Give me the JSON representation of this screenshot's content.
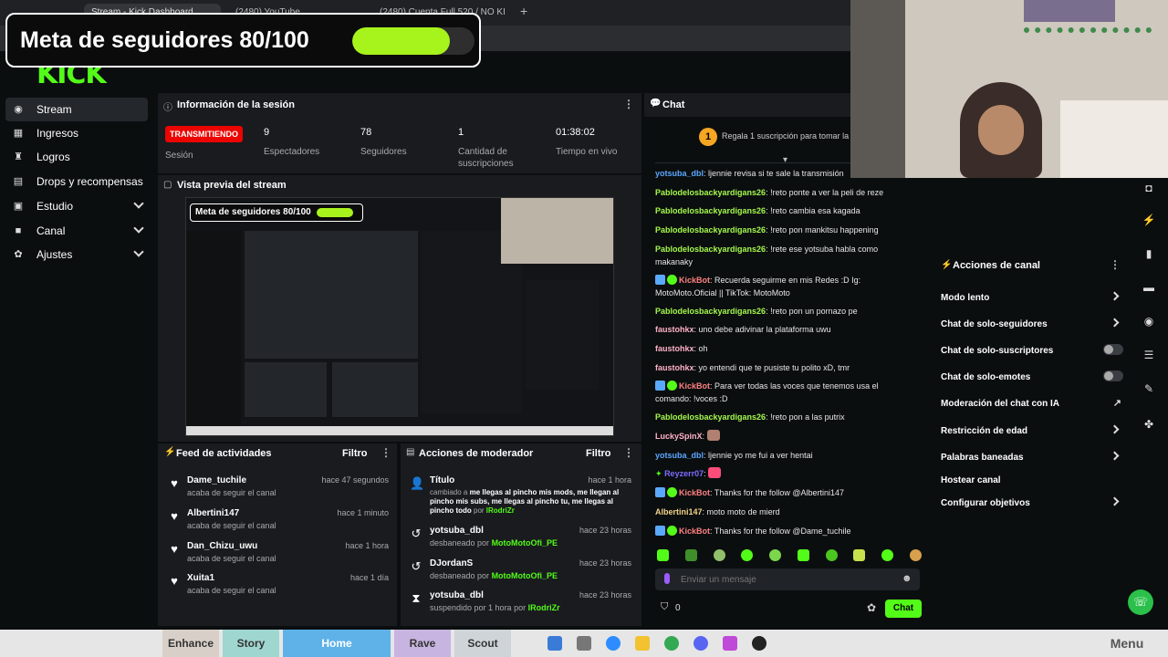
{
  "browser": {
    "tabs": [
      "Stream - Kick Dashboard",
      "(2480) YouTube",
      "(2480) Cuenta Full 520 / NO KI"
    ]
  },
  "goal": {
    "text": "Meta de seguidores 80/100",
    "fraction": 0.8
  },
  "logo": "KICK",
  "sidebar": {
    "items": [
      {
        "label": "Stream",
        "icon": "circle-dot-icon"
      },
      {
        "label": "Ingresos",
        "icon": "cash-icon"
      },
      {
        "label": "Logros",
        "icon": "trophy-icon"
      },
      {
        "label": "Drops y recompensas",
        "icon": "grid-icon"
      },
      {
        "label": "Estudio",
        "icon": "studio-icon"
      },
      {
        "label": "Canal",
        "icon": "channel-icon"
      },
      {
        "label": "Ajustes",
        "icon": "gear-icon"
      }
    ]
  },
  "session": {
    "title": "Información de la sesión",
    "status": "TRANSMITIENDO",
    "status_label": "Sesión",
    "stats": [
      {
        "value": "9",
        "label": "Espectadores"
      },
      {
        "value": "78",
        "label": "Seguidores"
      },
      {
        "value": "1",
        "label": "Cantidad de suscripciones"
      },
      {
        "value": "01:38:02",
        "label": "Tiempo en vivo"
      }
    ]
  },
  "preview": {
    "title": "Vista previa del stream",
    "goal_text": "Meta de seguidores 80/100"
  },
  "activity": {
    "title": "Feed de actividades",
    "filter": "Filtro",
    "items": [
      {
        "name": "Dame_tuchile",
        "sub": "acaba de seguir el canal",
        "time": "hace 47 segundos"
      },
      {
        "name": "Albertini147",
        "sub": "acaba de seguir el canal",
        "time": "hace 1 minuto"
      },
      {
        "name": "Dan_Chizu_uwu",
        "sub": "acaba de seguir el canal",
        "time": "hace 1 hora"
      },
      {
        "name": "Xuita1",
        "sub": "acaba de seguir el canal",
        "time": "hace 1 día"
      }
    ]
  },
  "modactions": {
    "title": "Acciones de moderador",
    "filter": "Filtro",
    "items": [
      {
        "name": "Título",
        "time": "hace 1 hora",
        "pre": "cambiado a ",
        "bold": "me llegas al pincho mis mods, me llegan al pincho mis subs, me llegas al pincho tu, me llegas al pincho todo",
        "by": " por ",
        "who": "lRodriZr"
      },
      {
        "name": "yotsuba_dbl",
        "time": "hace 23 horas",
        "pre": "desbaneado por ",
        "who": "MotoMotoOfi_PE"
      },
      {
        "name": "DJordanS",
        "time": "hace 23 horas",
        "pre": "desbaneado por ",
        "who": "MotoMotoOfi_PE"
      },
      {
        "name": "yotsuba_dbl",
        "time": "hace 23 horas",
        "pre": "suspendido por 1 hora por ",
        "who": "lRodriZr"
      }
    ]
  },
  "chat": {
    "title": "Chat",
    "gift": "Regala 1 suscripción para tomar la po",
    "input_placeholder": "Enviar un mensaje",
    "send": "Chat",
    "points": "0",
    "messages": [
      {
        "user": "yotsuba_dbl",
        "text": "ljennie revisa si te sale la transmisión"
      },
      {
        "user": "Pablodelosbackyardigans26",
        "text": "!reto ponte a ver la peli de reze"
      },
      {
        "user": "Pablodelosbackyardigans26",
        "text": "!reto cambia esa kagada"
      },
      {
        "user": "Pablodelosbackyardigans26",
        "text": "!reto pon mankitsu happening"
      },
      {
        "user": "Pablodelosbackyardigans26",
        "text": "!rete ese yotsuba habla como makanaky"
      },
      {
        "user": "KickBot",
        "text": "Recuerda seguirme en mis Redes :D Ig: MotoMoto.Oficial || TikTok: MotoMoto"
      },
      {
        "user": "Pablodelosbackyardigans26",
        "text": "!reto pon un pornazo pe"
      },
      {
        "user": "faustohkx",
        "text": "uno debe adivinar la plataforma uwu"
      },
      {
        "user": "faustohkx",
        "text": "oh"
      },
      {
        "user": "faustohkx",
        "text": "yo entendi que te pusiste tu polito xD, tmr"
      },
      {
        "user": "KickBot",
        "text": "Para ver todas las voces que tenemos usa el comando: !voces :D"
      },
      {
        "user": "Pablodelosbackyardigans26",
        "text": "!reto pon a las putrix"
      },
      {
        "user": "LuckySpinX",
        "text": ""
      },
      {
        "user": "yotsuba_dbl",
        "text": "ljennie yo me fui a ver hentai"
      },
      {
        "user": "Reyzerr07",
        "text": ""
      },
      {
        "user": "KickBot",
        "text": "Thanks for the follow @Albertini147"
      },
      {
        "user": "Albertini147",
        "text": "moto moto de mierd"
      },
      {
        "user": "KickBot",
        "text": "Thanks for the follow @Dame_tuchile"
      }
    ]
  },
  "channel_actions": {
    "title": "Acciones de canal",
    "items": [
      {
        "label": "Modo lento",
        "type": "arrow"
      },
      {
        "label": "Chat de solo-seguidores",
        "type": "arrow"
      },
      {
        "label": "Chat de solo-suscriptores",
        "type": "toggle"
      },
      {
        "label": "Chat de solo-emotes",
        "type": "toggle"
      },
      {
        "label": "Moderación del chat con IA",
        "type": "external"
      },
      {
        "label": "Restricción de edad",
        "type": "arrow"
      },
      {
        "label": "Palabras baneadas",
        "type": "arrow"
      },
      {
        "label": "Hostear canal",
        "type": "none"
      },
      {
        "label": "Configurar objetivos",
        "type": "arrow"
      }
    ]
  },
  "taskbar": {
    "items": [
      "Enhance",
      "Story",
      "Home",
      "Rave",
      "Scout",
      "Menu"
    ]
  },
  "colors": {
    "kick_green": "#53fc18",
    "live_red": "#eb0400",
    "goal_fill": "#a7f31c"
  }
}
